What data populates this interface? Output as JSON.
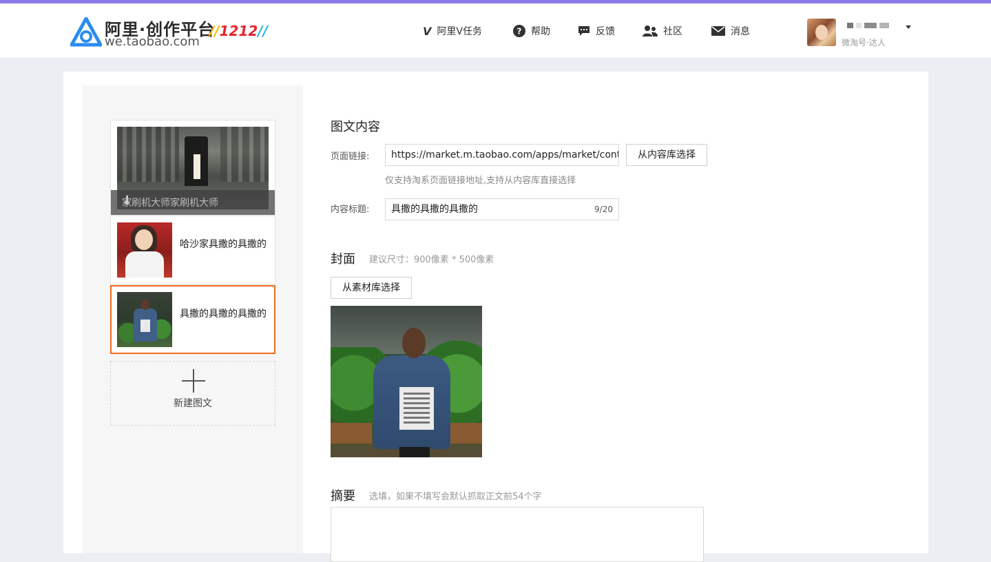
{
  "header": {
    "logo_title": "阿里·创作平台",
    "logo_url": "we.taobao.com",
    "logo_badge": "1212",
    "nav": [
      {
        "label": "阿里V任务",
        "icon": "v-icon"
      },
      {
        "label": "帮助",
        "icon": "help-icon"
      },
      {
        "label": "反馈",
        "icon": "feedback-icon"
      },
      {
        "label": "社区",
        "icon": "community-icon"
      },
      {
        "label": "消息",
        "icon": "message-icon"
      }
    ],
    "user": {
      "role": "微淘号·达人"
    }
  },
  "sidebar": {
    "cards": [
      {
        "title": "家刷机大师家刷机大师"
      },
      {
        "title": "哈沙家具撒的具撒的"
      },
      {
        "title": "具撒的具撒的具撒的"
      }
    ],
    "new_label": "新建图文"
  },
  "content": {
    "section_title": "图文内容",
    "link_label": "页面链接:",
    "link_value": "https://market.m.taobao.com/apps/market/content/",
    "link_button": "从内容库选择",
    "link_hint": "仅支持淘系页面链接地址,支持从内容库直接选择",
    "title_label": "内容标题:",
    "title_value": "具撒的具撒的具撒的",
    "title_counter": "9/20"
  },
  "cover": {
    "title": "封面",
    "hint": "建议尺寸：900像素 * 500像素",
    "button": "从素材库选择"
  },
  "summary": {
    "title": "摘要",
    "hint": "选填，如果不填写会默认抓取正文前54个字"
  },
  "colors": {
    "accent_bar": "#8b7be8",
    "selected_border": "#f06a1a",
    "logo_blue": "#1e90ff",
    "badge_red": "#e8232a"
  }
}
